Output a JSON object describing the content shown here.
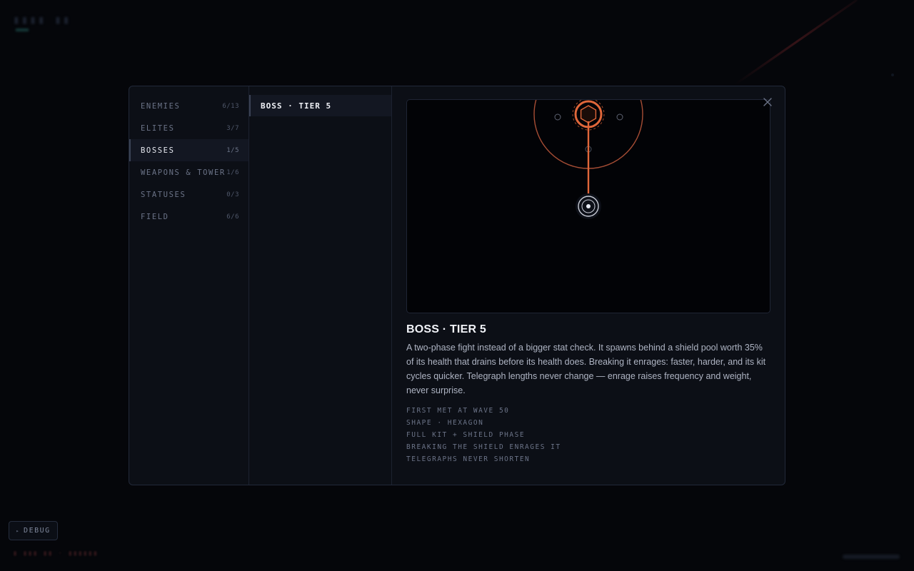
{
  "hud": {
    "debug_label": "DEBUG"
  },
  "codex": {
    "categories": [
      {
        "label": "ENEMIES",
        "count": "6/13",
        "active": false
      },
      {
        "label": "ELITES",
        "count": "3/7",
        "active": false
      },
      {
        "label": "BOSSES",
        "count": "1/5",
        "active": true
      },
      {
        "label": "WEAPONS & TOWER",
        "count": "1/6",
        "active": false
      },
      {
        "label": "STATUSES",
        "count": "0/3",
        "active": false
      },
      {
        "label": "FIELD",
        "count": "6/6",
        "active": false
      }
    ],
    "entries": [
      {
        "label": "BOSS · TIER 5",
        "selected": true
      }
    ],
    "detail": {
      "title": "BOSS · TIER 5",
      "description": "A two-phase fight instead of a bigger stat check. It spawns behind a shield pool worth 35% of its health that drains before its health does. Breaking it enrages: faster, harder, and its kit cycles quicker. Telegraph lengths never change — enrage raises frequency and weight, never surprise.",
      "facts": [
        "FIRST MET AT WAVE 50",
        "SHAPE · HEXAGON",
        "FULL KIT + SHIELD PHASE",
        "BREAKING THE SHIELD ENRAGES IT",
        "TELEGRAPHS NEVER SHORTEN"
      ],
      "close_icon": "close-icon"
    }
  },
  "colors": {
    "accent_orange": "#e0673a",
    "boss_ring": "#b8553a",
    "tower_white": "#e8ecf4"
  }
}
